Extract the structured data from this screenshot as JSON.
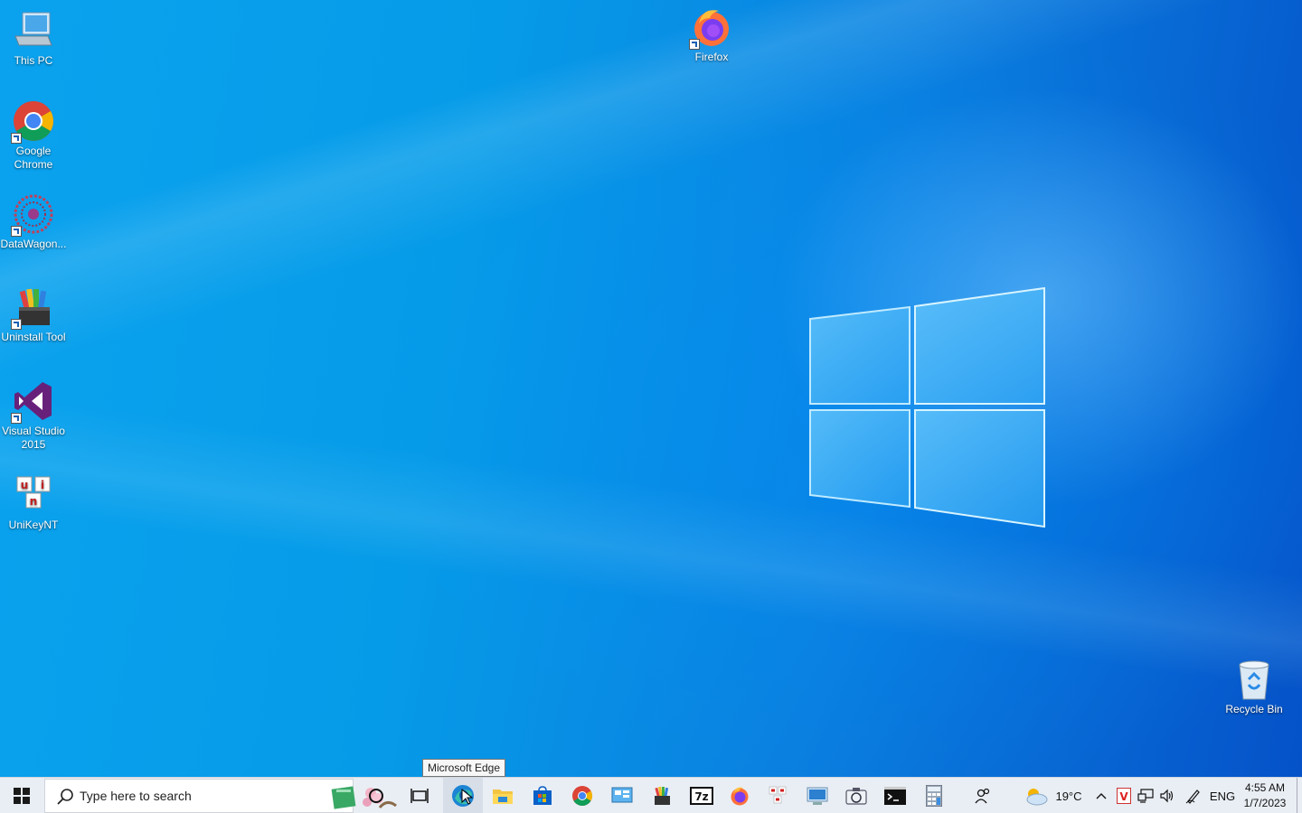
{
  "desktop": {
    "icons_left": [
      {
        "label": "This PC"
      },
      {
        "label": "Google Chrome"
      },
      {
        "label": "DataWagon..."
      },
      {
        "label": "Uninstall Tool"
      },
      {
        "label": "Visual Studio 2015"
      },
      {
        "label": "UniKeyNT"
      }
    ],
    "firefox": {
      "label": "Firefox"
    },
    "recycle_bin": {
      "label": "Recycle Bin"
    }
  },
  "tooltip": {
    "text": "Microsoft Edge"
  },
  "taskbar": {
    "search_placeholder": "Type here to search",
    "pinned": [
      "cortana-icon",
      "task-view-icon",
      "edge-icon",
      "file-explorer-icon",
      "store-icon",
      "chrome-icon",
      "control-panel-icon",
      "uninstall-tool-icon",
      "7zip-icon",
      "firefox-icon",
      "unikey-icon",
      "remote-desktop-icon",
      "camera-icon",
      "terminal-icon",
      "calculator-icon"
    ],
    "tray": {
      "temperature": "19°C",
      "language": "ENG"
    },
    "clock": {
      "time": "4:55 AM",
      "date": "1/7/2023"
    }
  },
  "colors": {
    "accent": "#0a7fe0",
    "taskbar": "#e9eef4"
  }
}
